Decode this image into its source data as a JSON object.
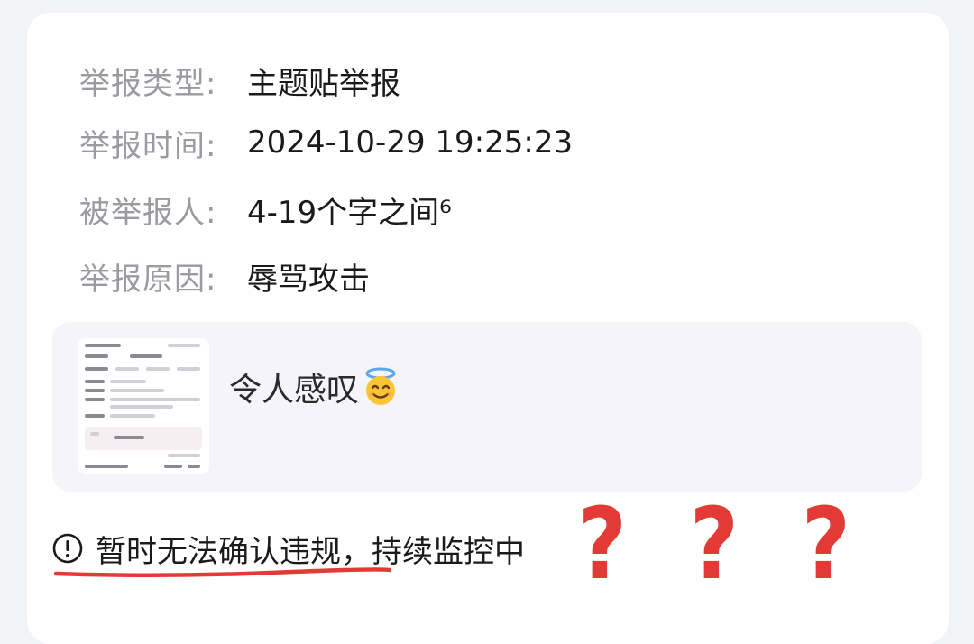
{
  "report": {
    "type_label": "举报类型:",
    "type_value": "主题贴举报",
    "time_label": "举报时间:",
    "time_value": "2024-10-29 19:25:23",
    "reported_label": "被举报人:",
    "reported_value": "4-19个字之间⁶",
    "reason_label": "举报原因:",
    "reason_value": "辱骂攻击"
  },
  "attachment": {
    "text": "令人感叹",
    "emoji_icon": "smiling-face-with-halo-icon",
    "thumbnail_icon": "screenshot-thumbnail"
  },
  "status": {
    "icon": "exclamation-circle-icon",
    "text": "暂时无法确认违规，持续监控中"
  },
  "annotations": {
    "question_marks": [
      "?",
      "?",
      "?"
    ],
    "question_color": "#e33a36",
    "underline_color": "#e33a36"
  }
}
